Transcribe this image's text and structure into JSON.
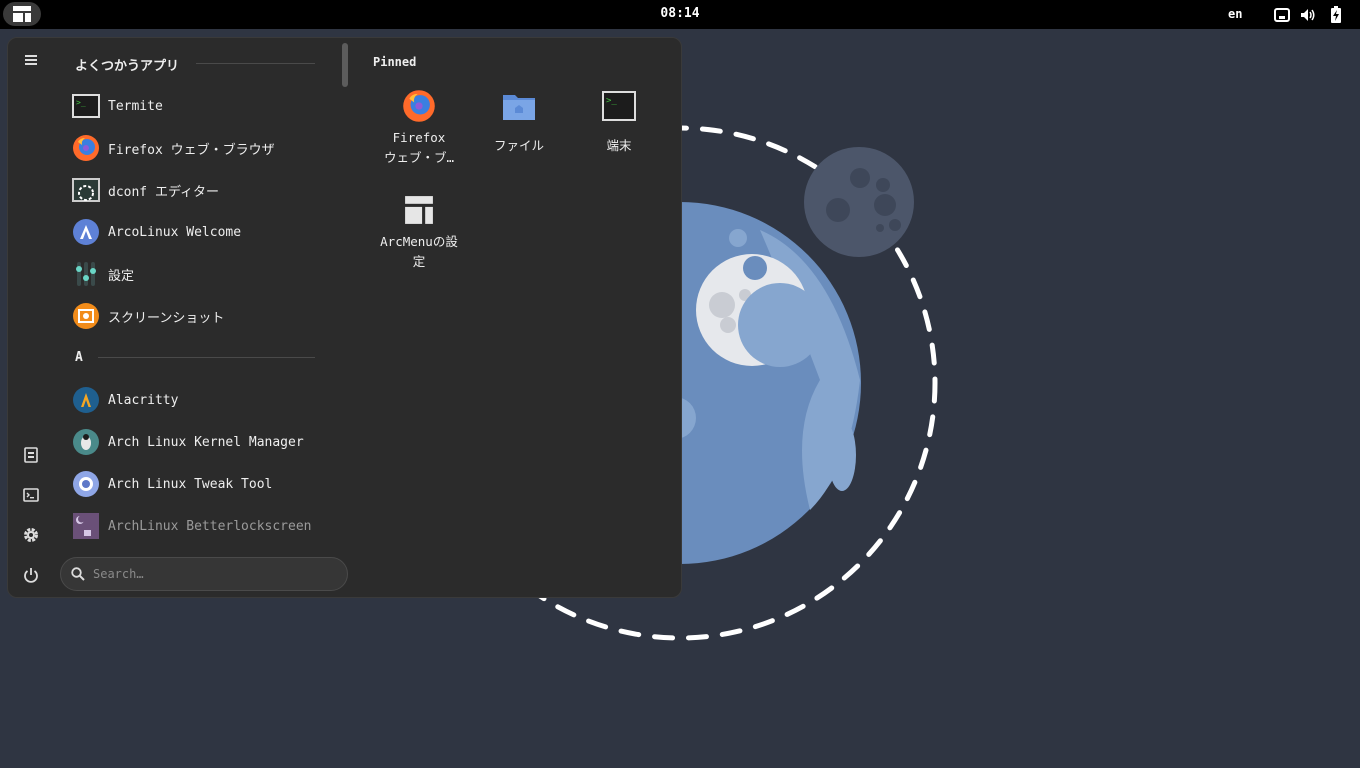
{
  "topbar": {
    "clock": "08:14",
    "lang": "en",
    "activities_icon": "layout-icon",
    "tray": [
      "network-icon",
      "volume-icon",
      "battery-charging-icon"
    ]
  },
  "menu": {
    "sidebar": [
      "document-icon",
      "terminal-icon",
      "settings-gear-icon",
      "power-icon"
    ],
    "frequent_header": "よくつかうアプリ",
    "frequent_apps": [
      {
        "label": "Termite",
        "icon": "terminal-icon"
      },
      {
        "label": "Firefox ウェブ・ブラウザ",
        "icon": "firefox-icon"
      },
      {
        "label": "dconf エディター",
        "icon": "dconf-editor-icon"
      },
      {
        "label": "ArcoLinux Welcome",
        "icon": "arcolinux-icon"
      },
      {
        "label": "設定",
        "icon": "settings-sliders-icon"
      },
      {
        "label": "スクリーンショット",
        "icon": "screenshot-icon"
      }
    ],
    "letter_header": "A",
    "a_apps": [
      {
        "label": "Alacritty",
        "icon": "alacritty-icon"
      },
      {
        "label": "Arch Linux Kernel Manager",
        "icon": "kernel-manager-icon"
      },
      {
        "label": "Arch Linux Tweak Tool",
        "icon": "tweak-tool-icon"
      },
      {
        "label": "ArchLinux Betterlockscreen",
        "icon": "lockscreen-icon"
      }
    ],
    "search_placeholder": "Search…",
    "pinned_title": "Pinned",
    "pinned": [
      {
        "label": "Firefox ウェブ・ブ…",
        "label_line1": "Firefox",
        "label_line2": "ウェブ・ブ…",
        "icon": "firefox-icon"
      },
      {
        "label": "ファイル",
        "icon": "folder-icon"
      },
      {
        "label": "端末",
        "icon": "terminal-icon"
      },
      {
        "label": "ArcMenuの設定",
        "label_line1": "ArcMenuの設",
        "label_line2": "定",
        "icon": "arcmenu-settings-icon"
      }
    ]
  },
  "colors": {
    "topbar": "#000000",
    "desktop": "#2f3542",
    "menu_bg": "#2b2b2b",
    "planet": "#6b8fbf",
    "moon": "#4a5568"
  }
}
